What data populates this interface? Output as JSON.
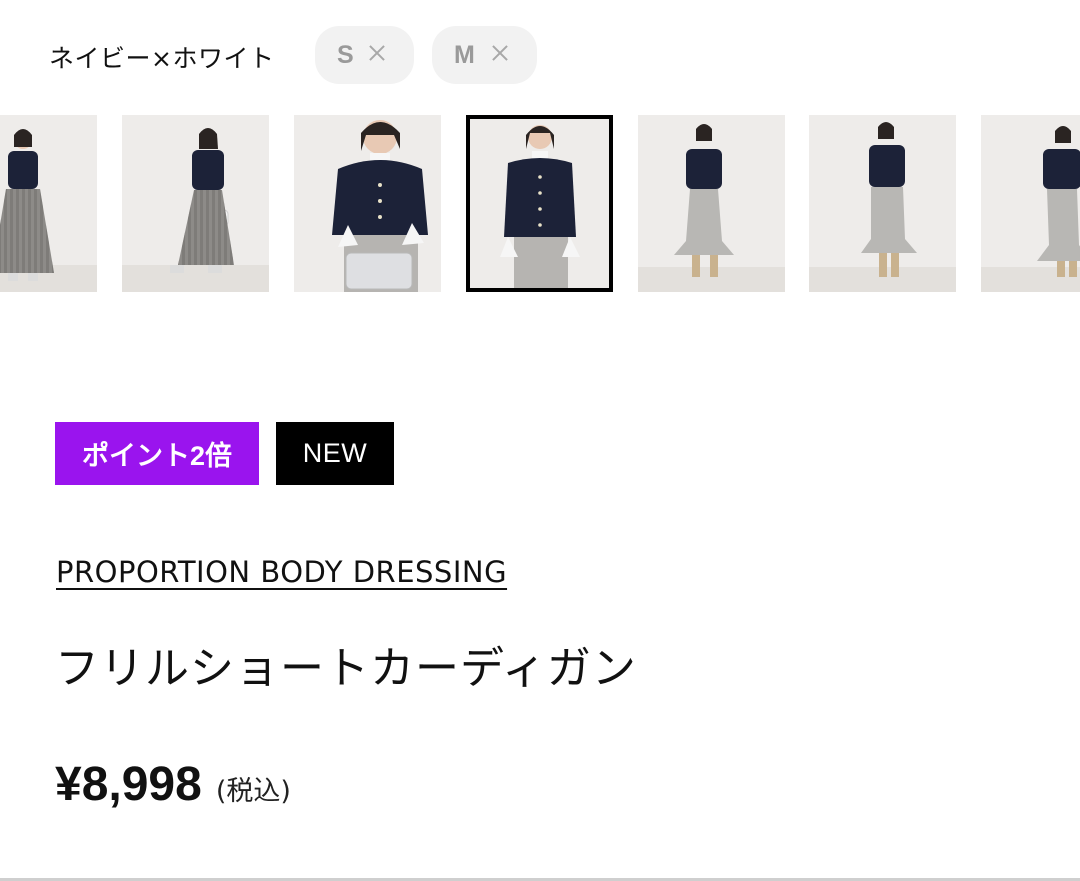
{
  "color_selector": {
    "selected_color": "ネイビー×ホワイト",
    "sizes": [
      {
        "label": "S",
        "icon": "close-icon"
      },
      {
        "label": "M",
        "icon": "close-icon"
      }
    ]
  },
  "thumbnails": {
    "selected_index": 3,
    "items": [
      {
        "alt": "look-1",
        "skirt": "pleated-grey"
      },
      {
        "alt": "look-2",
        "skirt": "pleated-grey"
      },
      {
        "alt": "look-3",
        "skirt": "tweed-grey"
      },
      {
        "alt": "look-4",
        "skirt": "tweed-grey"
      },
      {
        "alt": "look-5",
        "skirt": "mermaid-grey"
      },
      {
        "alt": "look-6",
        "skirt": "mermaid-grey"
      },
      {
        "alt": "look-7",
        "skirt": "mermaid-grey"
      }
    ]
  },
  "badges": {
    "points": "ポイント2倍",
    "new": "NEW"
  },
  "product": {
    "brand": "PROPORTION BODY DRESSING",
    "name": "フリルショートカーディガン",
    "price": "¥8,998",
    "tax_note": "(税込)"
  },
  "colors": {
    "points_badge": "#9a14ee",
    "new_badge": "#000000",
    "chip_bg": "#f2f2f2"
  }
}
